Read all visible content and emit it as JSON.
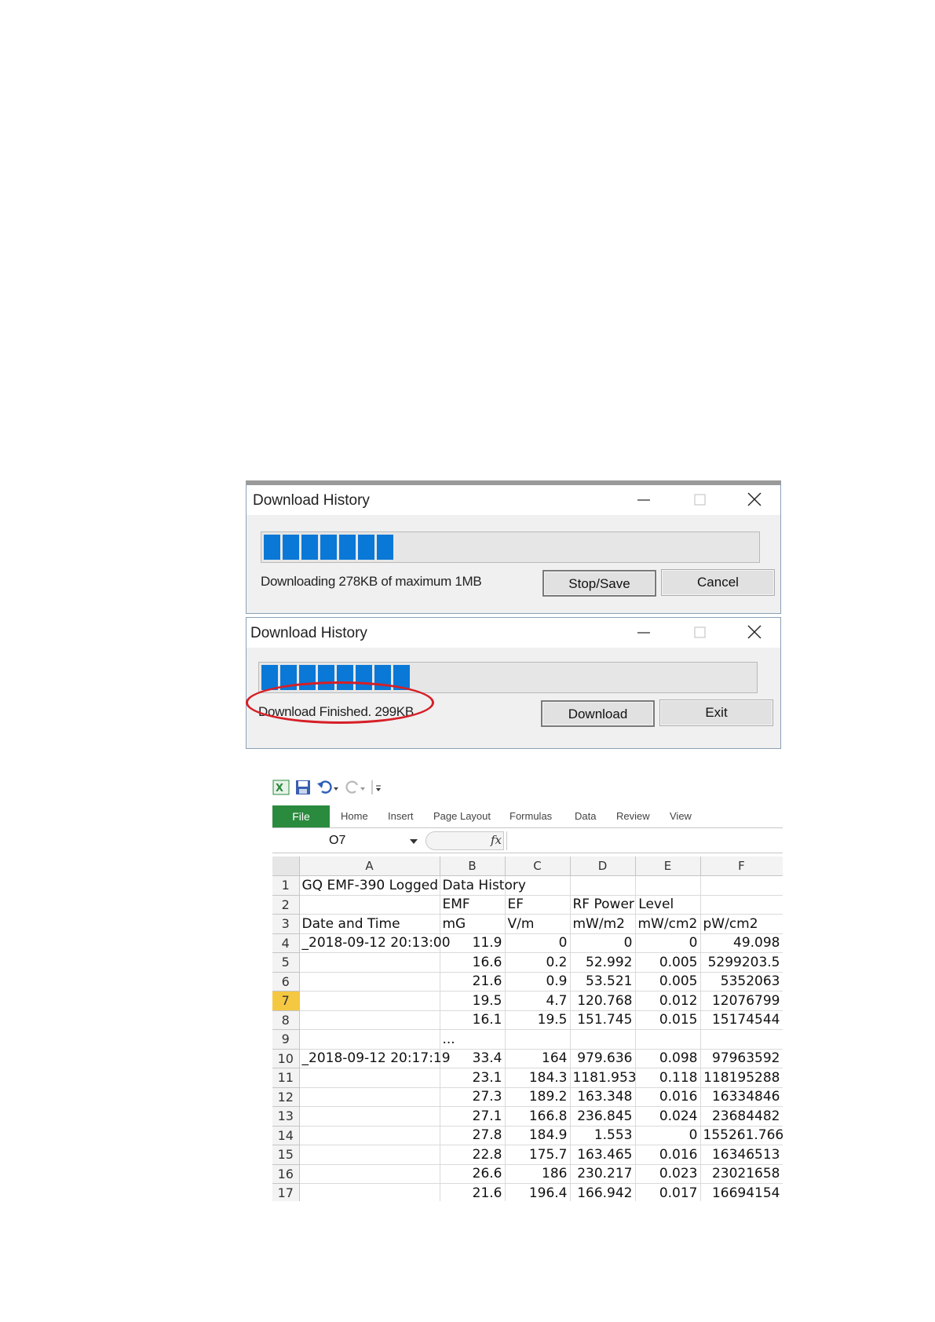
{
  "dialog1": {
    "title": "Download History",
    "progress_blocks": 7,
    "status": "Downloading 278KB of maximum 1MB",
    "primary_button": "Stop/Save",
    "secondary_button": "Cancel"
  },
  "dialog2": {
    "title": "Download History",
    "progress_blocks": 8,
    "status": "Download Finished. 299KB",
    "primary_button": "Download",
    "secondary_button": "Exit",
    "highlight_color": "#d61f26"
  },
  "excel": {
    "tabs": [
      "File",
      "Home",
      "Insert",
      "Page Layout",
      "Formulas",
      "Data",
      "Review",
      "View"
    ],
    "name_box": "O7",
    "fx_label": "fx",
    "columns": [
      "A",
      "B",
      "C",
      "D",
      "E",
      "F"
    ],
    "selected_row": "7",
    "accent_color": "#2a8a3e",
    "rows": [
      [
        "1",
        "GQ EMF-390 Logged Data History",
        "",
        "",
        "",
        "",
        ""
      ],
      [
        "2",
        "",
        "EMF",
        "EF",
        "RF Power Level",
        "",
        ""
      ],
      [
        "3",
        "Date and Time",
        "mG",
        "V/m",
        "mW/m2",
        "mW/cm2",
        "pW/cm2"
      ],
      [
        "4",
        "_2018-09-12 20:13:00",
        "11.9",
        "0",
        "0",
        "0",
        "49.098"
      ],
      [
        "5",
        "",
        "16.6",
        "0.2",
        "52.992",
        "0.005",
        "5299203.5"
      ],
      [
        "6",
        "",
        "21.6",
        "0.9",
        "53.521",
        "0.005",
        "5352063"
      ],
      [
        "7",
        "",
        "19.5",
        "4.7",
        "120.768",
        "0.012",
        "12076799"
      ],
      [
        "8",
        "",
        "16.1",
        "19.5",
        "151.745",
        "0.015",
        "15174544"
      ],
      [
        "9",
        "",
        "...",
        "",
        "",
        "",
        ""
      ],
      [
        "10",
        "_2018-09-12 20:17:19",
        "33.4",
        "164",
        "979.636",
        "0.098",
        "97963592"
      ],
      [
        "11",
        "",
        "23.1",
        "184.3",
        "1181.953",
        "0.118",
        "118195288"
      ],
      [
        "12",
        "",
        "27.3",
        "189.2",
        "163.348",
        "0.016",
        "16334846"
      ],
      [
        "13",
        "",
        "27.1",
        "166.8",
        "236.845",
        "0.024",
        "23684482"
      ],
      [
        "14",
        "",
        "27.8",
        "184.9",
        "1.553",
        "0",
        "155261.766"
      ],
      [
        "15",
        "",
        "22.8",
        "175.7",
        "163.465",
        "0.016",
        "16346513"
      ],
      [
        "16",
        "",
        "26.6",
        "186",
        "230.217",
        "0.023",
        "23021658"
      ],
      [
        "17",
        "",
        "21.6",
        "196.4",
        "166.942",
        "0.017",
        "16694154"
      ]
    ]
  }
}
